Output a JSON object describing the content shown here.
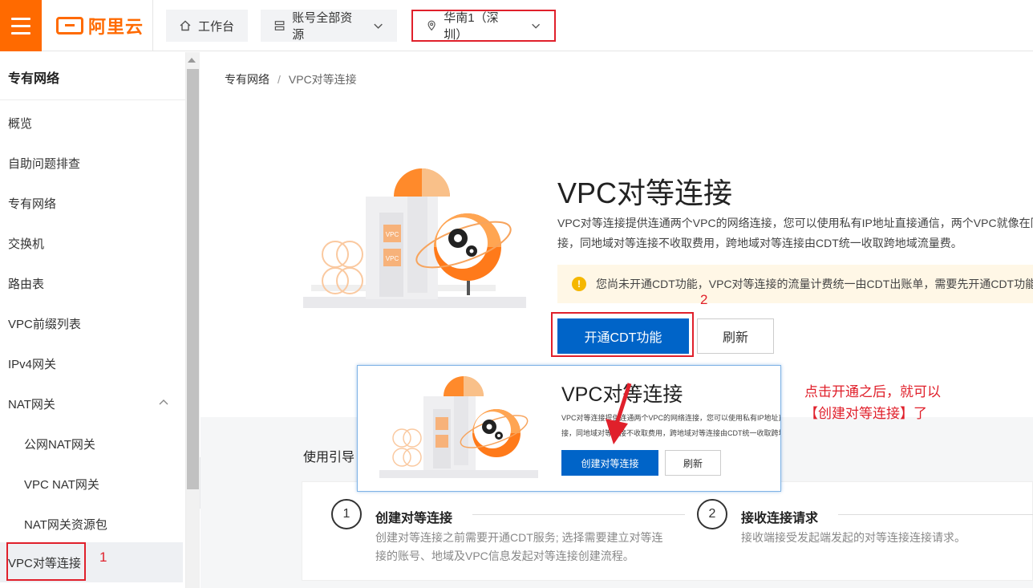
{
  "topbar": {
    "brand": "阿里云",
    "workbench_label": "工作台",
    "account_label": "账号全部资源",
    "region_label": "华南1（深圳）",
    "accent_color": "#ff6a00"
  },
  "sidebar": {
    "title": "专有网络",
    "items": [
      {
        "label": "概览"
      },
      {
        "label": "自助问题排查"
      },
      {
        "label": "专有网络"
      },
      {
        "label": "交换机"
      },
      {
        "label": "路由表"
      },
      {
        "label": "VPC前缀列表"
      },
      {
        "label": "IPv4网关"
      },
      {
        "label": "NAT网关"
      },
      {
        "label": "公网NAT网关"
      },
      {
        "label": "VPC NAT网关"
      },
      {
        "label": "NAT网关资源包"
      },
      {
        "label": "VPC对等连接"
      }
    ]
  },
  "breadcrumb": {
    "root": "专有网络",
    "separator": "/",
    "current": "VPC对等连接"
  },
  "hero": {
    "title": "VPC对等连接",
    "desc_line1": "VPC对等连接提供连通两个VPC的网络连接，您可以使用私有IP地址直接通信，两个VPC就像在同一个网络中一样。",
    "desc_line2": "接，同地域对等连接不收取费用，跨地域对等连接由CDT统一收取跨地域流量费。",
    "warning": "您尚未开通CDT功能，VPC对等连接的流量计费统一由CDT出账单，需要先开通CDT功能。",
    "primary_button": "开通CDT功能",
    "refresh_button": "刷新",
    "illus_label_1": "VPC",
    "illus_label_2": "VPC"
  },
  "guide": {
    "title": "使用引导",
    "steps": [
      {
        "num": "1",
        "title": "创建对等连接",
        "desc_line1": "创建对等连接之前需要开通CDT服务; 选择需要建立对等连",
        "desc_line2": "接的账号、地域及VPC信息发起对等连接创建流程。"
      },
      {
        "num": "2",
        "title": "接收连接请求",
        "desc_line1": "接收端接受发起端发起的对等连接连接请求。",
        "desc_line2": ""
      }
    ]
  },
  "popup": {
    "title": "VPC对等连接",
    "desc_line1": "VPC对等连接提供连通两个VPC的网络连接，您可以使用私有IP地址直接通信",
    "desc_line2": "接，同地域对等连接不收取费用，跨地域对等连接由CDT统一收取跨地域流量费。",
    "primary_button": "创建对等连接",
    "refresh_button": "刷新"
  },
  "annotations": {
    "marker_1": "1",
    "marker_2": "2",
    "note_line1": "点击开通之后，就可以",
    "note_line2": "【创建对等连接】了",
    "color": "#e0202b"
  },
  "colors": {
    "primary_blue": "#0064c8",
    "brand_orange": "#ff6a00",
    "warning_bg": "#fff7e6"
  }
}
